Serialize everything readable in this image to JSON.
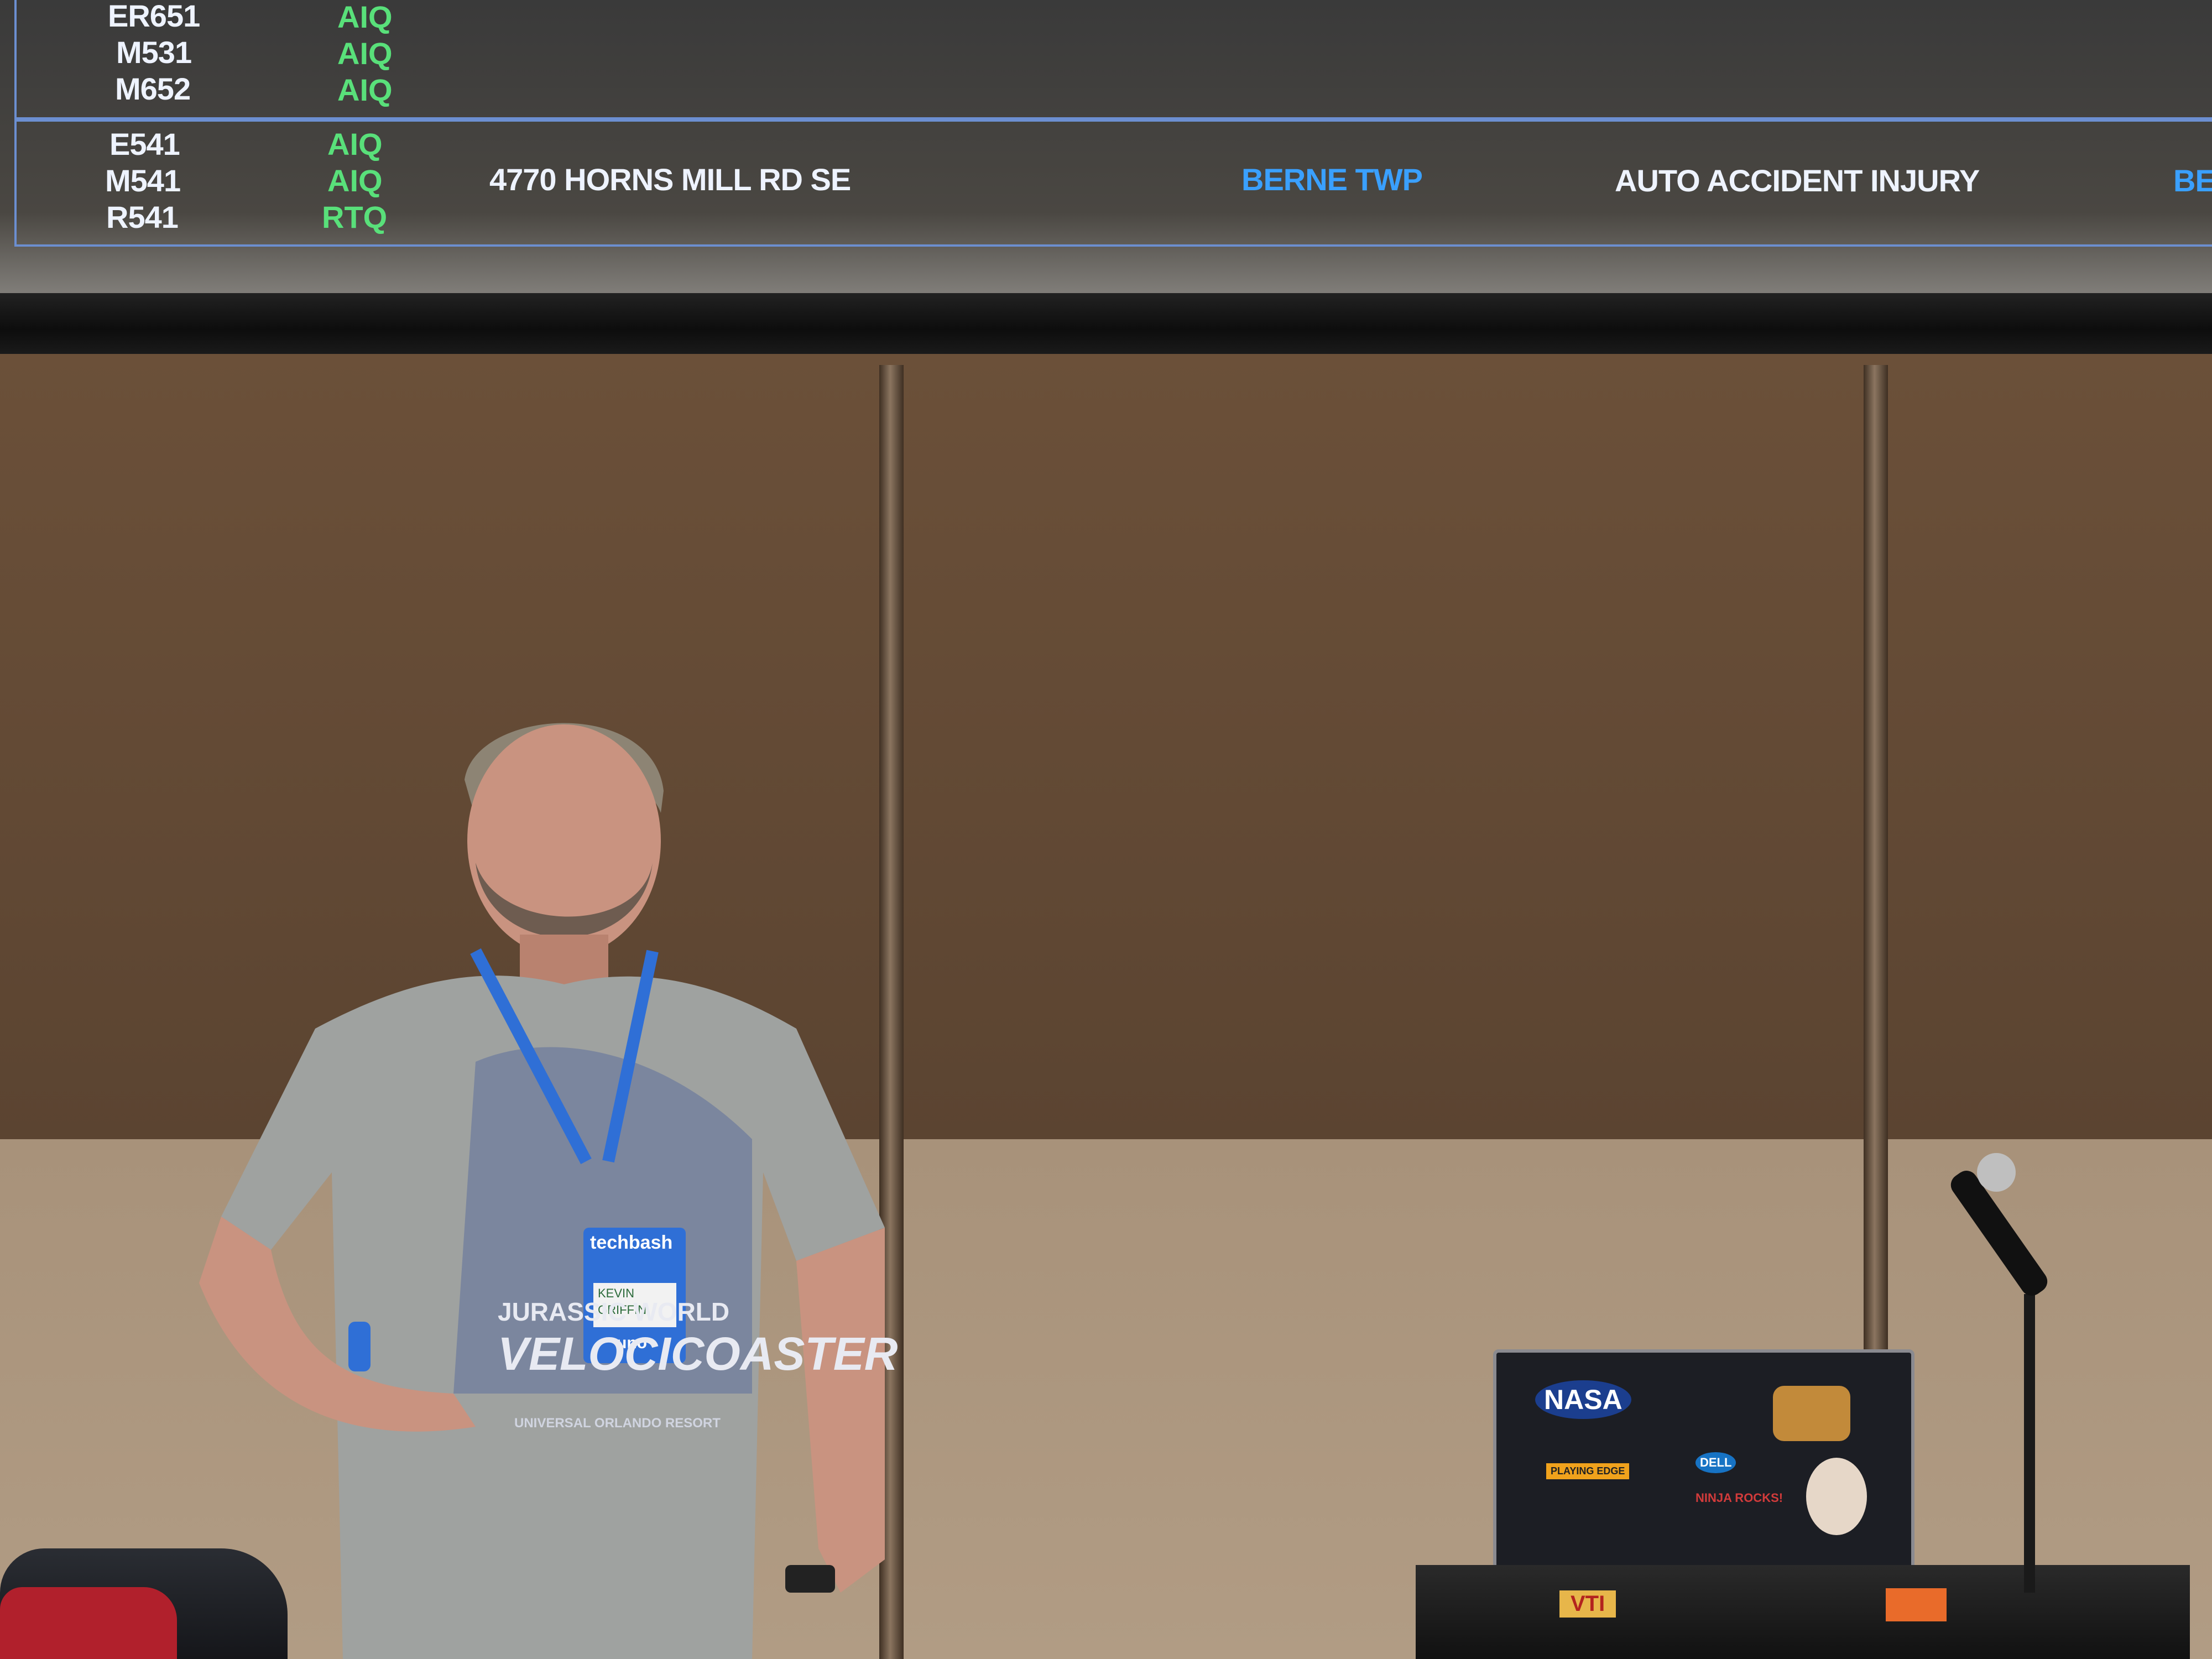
{
  "display": {
    "rows_top": [
      {
        "unit": "ER651",
        "status": "AIQ"
      },
      {
        "unit": "M531",
        "status": "AIQ"
      },
      {
        "unit": "M652",
        "status": "AIQ"
      }
    ],
    "rows_bottom": [
      {
        "unit": "E541",
        "status": "AIQ"
      },
      {
        "unit": "M541",
        "status": "AIQ"
      },
      {
        "unit": "R541",
        "status": "RTQ"
      }
    ],
    "address": "4770 HORNS MILL RD SE",
    "township": "BERNE TWP",
    "incident": "AUTO ACCIDENT INJURY",
    "overflow": "BE"
  },
  "badge": {
    "event": "techbash",
    "name_line1": "KEVIN",
    "name_line2": "GRIFFIN",
    "sponsor": "uno"
  },
  "shirt": {
    "line1": "JURASSIC WORLD",
    "line2": "VELOCICOASTER",
    "line3": "UNIVERSAL ORLANDO RESORT"
  },
  "laptop": {
    "sticker_nasa": "NASA",
    "sticker_playing": "PLAYING EDGE",
    "sticker_dell": "DELL",
    "sticker_ninja": "NINJA ROCKS!"
  },
  "equipment": {
    "rack_label": "VTI"
  },
  "colors": {
    "screen_border": "#6c8fd1",
    "unit_text": "#eef3ff",
    "status_green": "#59e07a",
    "township_blue": "#3aa0ff",
    "badge_blue": "#2f6fd6"
  }
}
